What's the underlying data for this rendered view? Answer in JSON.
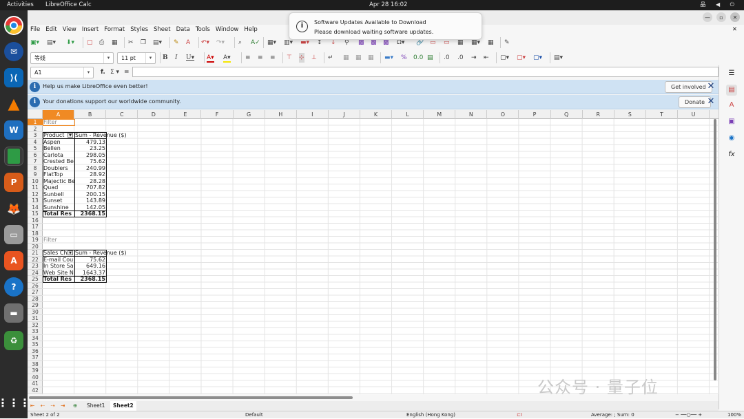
{
  "topbar": {
    "activities": "Activities",
    "app": "LibreOffice Calc",
    "clock": "Apr 28  16:02",
    "tray": "品 ◀ ⏻"
  },
  "window": {
    "title": "",
    "controls": [
      "—",
      "▫",
      "✕"
    ]
  },
  "menu": [
    "File",
    "Edit",
    "View",
    "Insert",
    "Format",
    "Styles",
    "Sheet",
    "Data",
    "Tools",
    "Window",
    "Help"
  ],
  "menu_close": "✕",
  "toolbar2": {
    "font_name": "等线",
    "font_size": "11 pt"
  },
  "formula": {
    "name_box": "A1",
    "fx": "f.",
    "sigma": "Σ ▾",
    "equals": "="
  },
  "infobar1": {
    "text": "Help us make LibreOffice even better!",
    "button": "Get involved"
  },
  "infobar2": {
    "text": "Your donations support our worldwide community.",
    "button": "Donate"
  },
  "columns": [
    "A",
    "B",
    "C",
    "D",
    "E",
    "F",
    "G",
    "H",
    "I",
    "J",
    "K",
    "L",
    "M",
    "N",
    "O",
    "P",
    "Q",
    "R",
    "S",
    "T",
    "U"
  ],
  "rows": [
    "1",
    "2",
    "3",
    "4",
    "5",
    "6",
    "7",
    "8",
    "9",
    "10",
    "11",
    "12",
    "13",
    "14",
    "15",
    "16",
    "17",
    "18",
    "19",
    "20",
    "21",
    "22",
    "23",
    "24",
    "25",
    "26",
    "27",
    "28",
    "29",
    "30",
    "31",
    "32",
    "33",
    "34",
    "35",
    "36",
    "37",
    "38",
    "39",
    "40",
    "41",
    "42"
  ],
  "pivot1": {
    "filter": "Filter",
    "header_a": "Product",
    "header_b": "Sum - Revenue ($)",
    "items": [
      [
        "Aspen",
        "479.13"
      ],
      [
        "Bellen",
        "23.25"
      ],
      [
        "Carlota",
        "298.05"
      ],
      [
        "Crested Be",
        "75.62"
      ],
      [
        "Doublers",
        "240.99"
      ],
      [
        "FlatTop",
        "28.92"
      ],
      [
        "Majectic Be",
        "28.28"
      ],
      [
        "Quad",
        "707.82"
      ],
      [
        "Sunbell",
        "200.15"
      ],
      [
        "Sunset",
        "143.89"
      ],
      [
        "Sunshine",
        "142.05"
      ]
    ],
    "total_label": "Total Res",
    "total_value": "2368.15"
  },
  "pivot2": {
    "filter": "Filter",
    "header_a": "Sales Cha",
    "header_b": "Sum - Revenue ($)",
    "items": [
      [
        "E-mail Cou",
        "75.62"
      ],
      [
        "In Store Sa",
        "649.16"
      ],
      [
        "Web Site N",
        "1643.37"
      ]
    ],
    "total_label": "Total Res",
    "total_value": "2368.15"
  },
  "sheets": {
    "tab1": "Sheet1",
    "tab2": "Sheet2",
    "nav": "⇤ ⇠ ⇢ ⇥"
  },
  "status": {
    "sheet": "Sheet 2 of 2",
    "style": "Default",
    "language": "English (Hong Kong)",
    "summary": "Average: ; Sum: 0",
    "zoom": "100%"
  },
  "notification": {
    "title": "Software Updates Available to Download",
    "body": "Please download waiting software updates."
  },
  "watermark": "公众号 · 量子位",
  "colors": {
    "accent": "#f08a24",
    "infobar": "#cfe2f3",
    "dock": "#2c2c2c"
  }
}
